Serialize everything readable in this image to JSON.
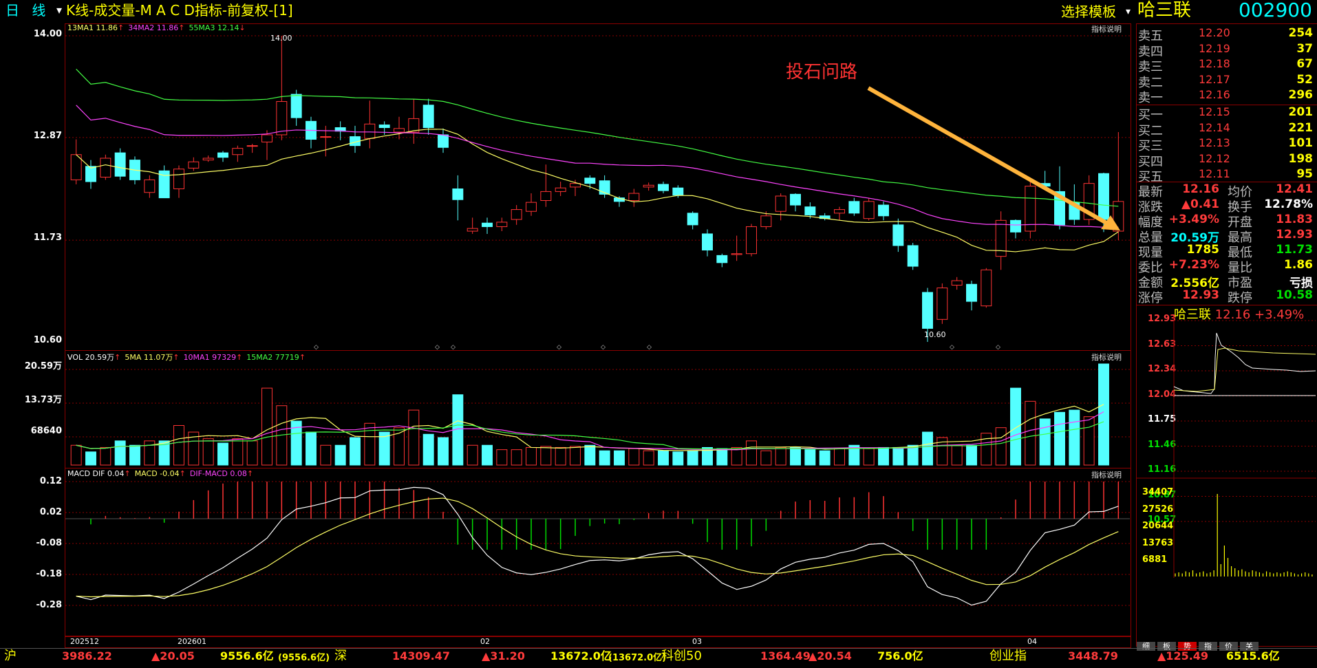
{
  "titlebar": {
    "period": "日 线",
    "period_arrow": "▾",
    "title": "K线-成交量-M A C D指标-前复权-[1]",
    "template_select": "选择模板",
    "stock_name": "哈三联",
    "stock_code": "002900"
  },
  "kline": {
    "legend": [
      {
        "text": "13MA1 11.86",
        "arrow": "↑",
        "color": "#ffff66"
      },
      {
        "text": "34MA2 11.86",
        "arrow": "↑",
        "color": "#ff44ff"
      },
      {
        "text": "55MA3 12.14",
        "arrow": "↓",
        "color": "#44ff44"
      }
    ],
    "help": "指标说明",
    "yaxis": [
      "14.00",
      "12.87",
      "11.73",
      "10.60"
    ],
    "high_label": "14.00",
    "low_label": "10.60",
    "annotation": "投石问路"
  },
  "vol": {
    "legend": [
      {
        "text": "VOL 20.59万",
        "arrow": "↑",
        "color": "#ffffff"
      },
      {
        "text": "5MA 11.07万",
        "arrow": "↑",
        "color": "#ffff66"
      },
      {
        "text": "10MA1 97329",
        "arrow": "↑",
        "color": "#ff44ff"
      },
      {
        "text": "15MA2 77719",
        "arrow": "↑",
        "color": "#44ff44"
      }
    ],
    "help": "指标说明",
    "yaxis": [
      "20.59万",
      "13.73万",
      "68640"
    ]
  },
  "macd": {
    "legend": [
      {
        "text": "MACD DIF 0.04",
        "arrow": "↑",
        "color": "#ffffff"
      },
      {
        "text": "MACD -0.04",
        "arrow": "↑",
        "color": "#ffff66"
      },
      {
        "text": "DIF-MACD 0.08",
        "arrow": "↑",
        "color": "#ff44ff"
      }
    ],
    "help": "指标说明",
    "yaxis": [
      "0.12",
      "0.02",
      "-0.08",
      "-0.18",
      "-0.28"
    ]
  },
  "xaxis": [
    "202512",
    "202601",
    "02",
    "03",
    "04"
  ],
  "orderbook": {
    "sell": [
      {
        "label": "卖五",
        "price": "12.20",
        "vol": "254"
      },
      {
        "label": "卖四",
        "price": "12.19",
        "vol": "37"
      },
      {
        "label": "卖三",
        "price": "12.18",
        "vol": "67"
      },
      {
        "label": "卖二",
        "price": "12.17",
        "vol": "52"
      },
      {
        "label": "卖一",
        "price": "12.16",
        "vol": "296"
      }
    ],
    "buy": [
      {
        "label": "买一",
        "price": "12.15",
        "vol": "201"
      },
      {
        "label": "买二",
        "price": "12.14",
        "vol": "221"
      },
      {
        "label": "买三",
        "price": "12.13",
        "vol": "101"
      },
      {
        "label": "买四",
        "price": "12.12",
        "vol": "198"
      },
      {
        "label": "买五",
        "price": "12.11",
        "vol": "95"
      }
    ]
  },
  "quote": [
    {
      "l1": "最新",
      "v1": "12.16",
      "c1": "#ff3b3b",
      "l2": "均价",
      "v2": "12.41",
      "c2": "#ff3b3b"
    },
    {
      "l1": "涨跌",
      "v1": "▲0.41",
      "c1": "#ff3b3b",
      "l2": "换手",
      "v2": "12.78%",
      "c2": "#ffffff"
    },
    {
      "l1": "幅度",
      "v1": "+3.49%",
      "c1": "#ff3b3b",
      "l2": "开盘",
      "v2": "11.83",
      "c2": "#ff3b3b"
    },
    {
      "l1": "总量",
      "v1": "20.59万",
      "c1": "#00ffff",
      "l2": "最高",
      "v2": "12.93",
      "c2": "#ff3b3b"
    },
    {
      "l1": "现量",
      "v1": "1785",
      "c1": "#ffff00",
      "l2": "最低",
      "v2": "11.73",
      "c2": "#00e000"
    },
    {
      "l1": "委比",
      "v1": "+7.23%",
      "c1": "#ff3b3b",
      "l2": "量比",
      "v2": "1.86",
      "c2": "#ffff00"
    },
    {
      "l1": "金额",
      "v1": "2.556亿",
      "c1": "#ffff00",
      "l2": "市盈",
      "v2": "亏损",
      "c2": "#ffffff"
    },
    {
      "l1": "涨停",
      "v1": "12.93",
      "c1": "#ff3b3b",
      "l2": "跌停",
      "v2": "10.58",
      "c2": "#00e000"
    }
  ],
  "intraday": {
    "name": "哈三联",
    "price": "12.16",
    "change": "+3.49%",
    "price_axis": [
      "12.93",
      "12.63",
      "12.34",
      "12.04",
      "11.75",
      "11.46",
      "11.16",
      "10.87",
      "10.57"
    ],
    "vol_axis": [
      "34407",
      "27526",
      "20644",
      "13763",
      "6881"
    ]
  },
  "tabs": [
    "细",
    "板",
    "势",
    "指",
    "价",
    "关"
  ],
  "statusbar": [
    {
      "label": "沪",
      "value": "3986.22",
      "change": "▲20.05",
      "amount": "9556.6亿",
      "amount2": "(9556.6亿)"
    },
    {
      "label": "深",
      "value": "14309.47",
      "change": "▲31.20",
      "amount": "13672.0亿",
      "amount2": "(13672.0亿)"
    },
    {
      "label": "科创50",
      "value": "1364.49",
      "change": "▲20.54",
      "amount": "756.0亿",
      "amount2": ""
    },
    {
      "label": "创业指",
      "value": "3448.79",
      "change": "▲125.49",
      "amount": "6515.6亿",
      "amount2": ""
    }
  ],
  "chart_data": {
    "type": "candlestick",
    "title": "K线-成交量-M A C D指标-前复权-[1]",
    "ylim": [
      10.6,
      14.0
    ],
    "candles": [
      [
        12.4,
        12.68,
        12.85,
        12.35
      ],
      [
        12.55,
        12.38,
        12.62,
        12.3
      ],
      [
        12.43,
        12.64,
        12.68,
        12.4
      ],
      [
        12.7,
        12.44,
        12.75,
        12.4
      ],
      [
        12.62,
        12.4,
        12.66,
        12.35
      ],
      [
        12.26,
        12.4,
        12.45,
        12.2
      ],
      [
        12.5,
        12.2,
        12.56,
        12.2
      ],
      [
        12.3,
        12.52,
        12.56,
        12.2
      ],
      [
        12.53,
        12.6,
        12.65,
        12.5
      ],
      [
        12.62,
        12.64,
        12.67,
        12.6
      ],
      [
        12.7,
        12.65,
        12.72,
        12.6
      ],
      [
        12.68,
        12.75,
        12.78,
        12.6
      ],
      [
        12.78,
        12.78,
        12.8,
        12.7
      ],
      [
        12.82,
        12.9,
        12.95,
        12.62
      ],
      [
        12.9,
        13.27,
        14.0,
        12.84
      ],
      [
        13.35,
        13.09,
        13.4,
        13.0
      ],
      [
        13.05,
        12.85,
        13.1,
        12.75
      ],
      [
        12.88,
        12.88,
        13.0,
        12.66
      ],
      [
        12.98,
        12.94,
        13.05,
        12.84
      ],
      [
        12.88,
        12.78,
        13.0,
        12.7
      ],
      [
        12.86,
        13.02,
        13.28,
        12.75
      ],
      [
        13.01,
        12.98,
        13.05,
        12.9
      ],
      [
        12.93,
        12.97,
        13.1,
        12.85
      ],
      [
        12.93,
        13.08,
        13.3,
        12.8
      ],
      [
        13.23,
        12.98,
        13.3,
        12.9
      ],
      [
        12.9,
        12.76,
        12.97,
        12.7
      ],
      [
        12.3,
        12.18,
        12.45,
        11.95
      ],
      [
        11.83,
        11.86,
        11.98,
        11.8
      ],
      [
        11.92,
        11.88,
        11.98,
        11.8
      ],
      [
        11.88,
        11.93,
        11.98,
        11.83
      ],
      [
        11.96,
        12.07,
        12.12,
        11.9
      ],
      [
        12.05,
        12.15,
        12.25,
        12.0
      ],
      [
        12.17,
        12.27,
        12.57,
        12.1
      ],
      [
        12.27,
        12.31,
        12.38,
        12.22
      ],
      [
        12.32,
        12.36,
        12.4,
        12.22
      ],
      [
        12.42,
        12.36,
        12.45,
        12.3
      ],
      [
        12.39,
        12.24,
        12.45,
        12.2
      ],
      [
        12.2,
        12.16,
        12.22,
        12.1
      ],
      [
        12.17,
        12.25,
        12.3,
        12.1
      ],
      [
        12.32,
        12.34,
        12.37,
        12.28
      ],
      [
        12.35,
        12.28,
        12.38,
        12.25
      ],
      [
        12.31,
        12.23,
        12.34,
        12.2
      ],
      [
        12.03,
        11.9,
        12.05,
        11.85
      ],
      [
        11.8,
        11.62,
        11.85,
        11.55
      ],
      [
        11.56,
        11.48,
        11.58,
        11.43
      ],
      [
        11.57,
        11.58,
        11.78,
        11.5
      ],
      [
        11.58,
        11.88,
        11.91,
        11.55
      ],
      [
        11.88,
        12.0,
        12.05,
        11.85
      ],
      [
        12.05,
        12.22,
        12.25,
        11.95
      ],
      [
        12.24,
        12.12,
        12.25,
        12.05
      ],
      [
        12.1,
        12.01,
        12.15,
        11.97
      ],
      [
        12.0,
        11.97,
        12.03,
        11.95
      ],
      [
        12.03,
        12.07,
        12.1,
        11.95
      ],
      [
        12.16,
        12.03,
        12.2,
        12.0
      ],
      [
        11.97,
        12.16,
        12.2,
        11.95
      ],
      [
        12.12,
        12.0,
        12.16,
        11.95
      ],
      [
        11.9,
        11.67,
        11.97,
        11.6
      ],
      [
        11.67,
        11.44,
        11.7,
        11.4
      ],
      [
        11.15,
        10.75,
        11.2,
        10.6
      ],
      [
        10.85,
        11.2,
        11.25,
        10.8
      ],
      [
        11.23,
        11.28,
        11.32,
        11.18
      ],
      [
        11.24,
        11.05,
        11.28,
        10.95
      ],
      [
        11.0,
        11.4,
        11.42,
        10.98
      ],
      [
        11.55,
        11.95,
        12.05,
        11.4
      ],
      [
        11.95,
        11.82,
        11.96,
        11.75
      ],
      [
        11.83,
        12.33,
        12.4,
        11.75
      ],
      [
        12.36,
        12.33,
        12.5,
        12.3
      ],
      [
        12.27,
        11.9,
        12.55,
        11.85
      ],
      [
        12.15,
        11.96,
        12.35,
        11.9
      ],
      [
        11.96,
        12.36,
        12.45,
        11.9
      ],
      [
        12.47,
        11.96,
        12.48,
        11.82
      ],
      [
        11.83,
        12.16,
        12.93,
        11.73
      ]
    ],
    "volume": [
      18,
      12,
      16,
      22,
      18,
      22,
      22,
      36,
      30,
      24,
      20,
      24,
      22,
      70,
      54,
      40,
      30,
      18,
      18,
      25,
      38,
      30,
      34,
      50,
      28,
      25,
      64,
      18,
      18,
      14,
      14,
      16,
      17,
      16,
      17,
      18,
      13,
      13,
      15,
      13,
      13,
      12,
      13,
      16,
      15,
      16,
      22,
      13,
      16,
      16,
      14,
      13,
      15,
      18,
      15,
      16,
      16,
      18,
      30,
      25,
      18,
      18,
      29,
      34,
      70,
      58,
      42,
      48,
      50,
      44,
      92
    ],
    "vol_ylim": [
      0,
      20.59
    ],
    "macd_ylim": [
      -0.28,
      0.12
    ],
    "xlabels": [
      "202512",
      "202601",
      "02",
      "03",
      "04"
    ]
  }
}
